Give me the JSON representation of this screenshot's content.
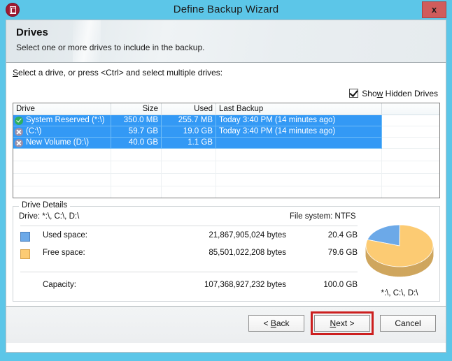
{
  "window": {
    "title": "Define Backup Wizard",
    "app_icon": "backup-app-icon",
    "close_label": "x",
    "frame_color": "#5CC6E8"
  },
  "banner": {
    "title": "Drives",
    "subtitle": "Select one or more drives to include in the backup."
  },
  "body": {
    "instruction_pre": "S",
    "instruction_post": "elect a drive, or press <Ctrl> and select multiple drives:",
    "instruction_full": "Select a drive, or press <Ctrl> and select multiple drives:"
  },
  "hidden_drives": {
    "label_pre": "Sho",
    "label_accel": "w",
    "label_post": " Hidden Drives",
    "label_full": "Show Hidden Drives",
    "checked": true
  },
  "drive_list": {
    "columns": [
      "Drive",
      "Size",
      "Used",
      "Last Backup",
      ""
    ],
    "rows": [
      {
        "state": "included",
        "drive": "System Reserved (*:\\)",
        "size": "350.0 MB",
        "used": "255.7 MB",
        "last_backup": "Today 3:40 PM (14 minutes ago)",
        "selected": true
      },
      {
        "state": "excluded",
        "drive": "(C:\\)",
        "size": "59.7 GB",
        "used": "19.0 GB",
        "last_backup": "Today 3:40 PM (14 minutes ago)",
        "selected": true
      },
      {
        "state": "excluded",
        "drive": "New Volume (D:\\)",
        "size": "40.0 GB",
        "used": "1.1 GB",
        "last_backup": "",
        "selected": true
      }
    ],
    "empty_rows": 5,
    "selection_color": "#3399F5"
  },
  "details": {
    "legend": "Drive Details",
    "drive_line": "Drive: *:\\, C:\\, D:\\",
    "file_system_line": "File system: NTFS",
    "rows": [
      {
        "swatch": "blue",
        "label": "Used space:",
        "bytes": "21,867,905,024 bytes",
        "gb": "20.4 GB"
      },
      {
        "swatch": "orange",
        "label": "Free space:",
        "bytes": "85,501,022,208 bytes",
        "gb": "79.6 GB"
      },
      {
        "swatch": "none",
        "label": "Capacity:",
        "bytes": "107,368,927,232 bytes",
        "gb": "100.0 GB"
      }
    ],
    "pie_caption": "*:\\, C:\\, D:\\"
  },
  "chart_data": {
    "type": "pie",
    "title": "Drive space usage",
    "labels": [
      "Used space",
      "Free space"
    ],
    "values": [
      20.4,
      79.6
    ],
    "value_unit": "GB",
    "bytes": [
      21867905024,
      85501022208
    ],
    "total_bytes": 107368927232,
    "total_gb": 100.0,
    "percentages": [
      20.4,
      79.6
    ],
    "colors": [
      "#6CA9E8",
      "#FCCB73"
    ],
    "legend_position": "left",
    "caption": "*:\\, C:\\, D:\\",
    "grid": false,
    "three_d": true
  },
  "footer": {
    "back": {
      "pre": "< ",
      "accel": "B",
      "post": "ack",
      "full": "< Back"
    },
    "next": {
      "pre": "",
      "accel": "N",
      "post": "ext >",
      "full": "Next >"
    },
    "cancel": {
      "full": "Cancel"
    },
    "highlight_color": "#CC1F1F",
    "highlighted_button": "next"
  }
}
